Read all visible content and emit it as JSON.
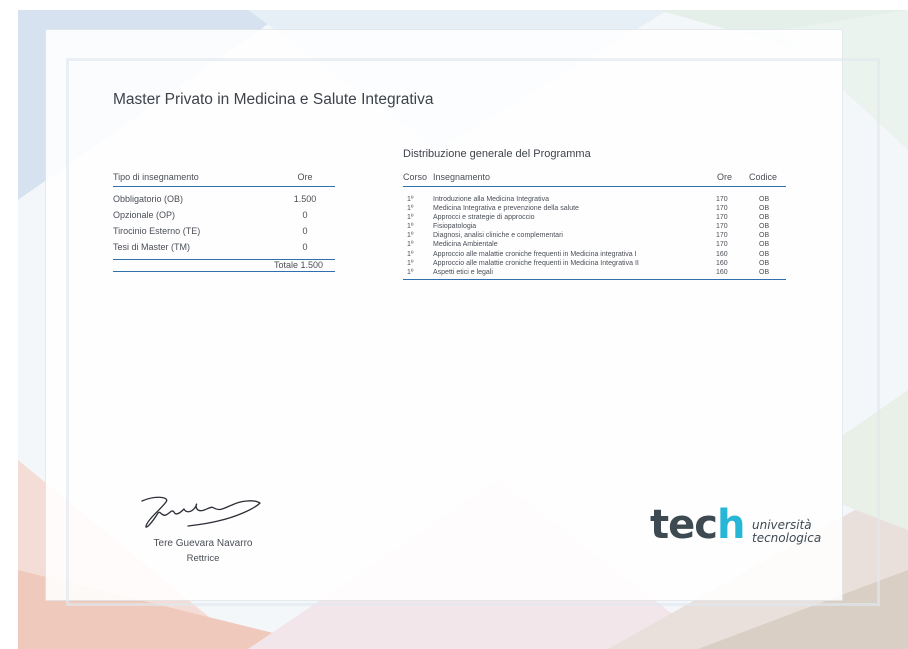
{
  "document": {
    "title": "Master Privato in Medicina e Salute Integrativa"
  },
  "summary_table": {
    "header_type": "Tipo di insegnamento",
    "header_hours": "Ore",
    "rows": [
      {
        "type": "Obbligatorio (OB)",
        "hours": "1.500"
      },
      {
        "type": "Opzionale (OP)",
        "hours": "0"
      },
      {
        "type": "Tirocinio Esterno (TE)",
        "hours": "0"
      },
      {
        "type": "Tesi di Master (TM)",
        "hours": "0"
      }
    ],
    "total": "Totale 1.500"
  },
  "distribution": {
    "title": "Distribuzione generale del Programma",
    "headers": {
      "course": "Corso",
      "subject": "Insegnamento",
      "hours": "Ore",
      "code": "Codice"
    },
    "rows": [
      {
        "course": "1º",
        "subject": "Introduzione alla Medicina Integrativa",
        "hours": "170",
        "code": "OB"
      },
      {
        "course": "1º",
        "subject": "Medicina Integrativa e prevenzione della salute",
        "hours": "170",
        "code": "OB"
      },
      {
        "course": "1º",
        "subject": "Approcci e strategie di approccio",
        "hours": "170",
        "code": "OB"
      },
      {
        "course": "1º",
        "subject": "Fisiopatologia",
        "hours": "170",
        "code": "OB"
      },
      {
        "course": "1º",
        "subject": "Diagnosi, analisi cliniche e complementari",
        "hours": "170",
        "code": "OB"
      },
      {
        "course": "1º",
        "subject": "Medicina Ambientale",
        "hours": "170",
        "code": "OB"
      },
      {
        "course": "1º",
        "subject": "Approccio alle malattie croniche frequenti in Medicina integrativa I",
        "hours": "160",
        "code": "OB"
      },
      {
        "course": "1º",
        "subject": "Approccio alle malattie croniche frequenti in Medicina Integrativa II",
        "hours": "160",
        "code": "OB"
      },
      {
        "course": "1º",
        "subject": "Aspetti etici e legali",
        "hours": "160",
        "code": "OB"
      }
    ]
  },
  "signatory": {
    "name": "Tere Guevara Navarro",
    "role": "Rettrice"
  },
  "logo": {
    "word_main": "tec",
    "word_accent": "h",
    "line1": "università",
    "line2": "tecnologica"
  },
  "colors": {
    "accent_blue": "#2f6fae",
    "logo_dark": "#3d4a52",
    "logo_cyan": "#28b6d7"
  }
}
